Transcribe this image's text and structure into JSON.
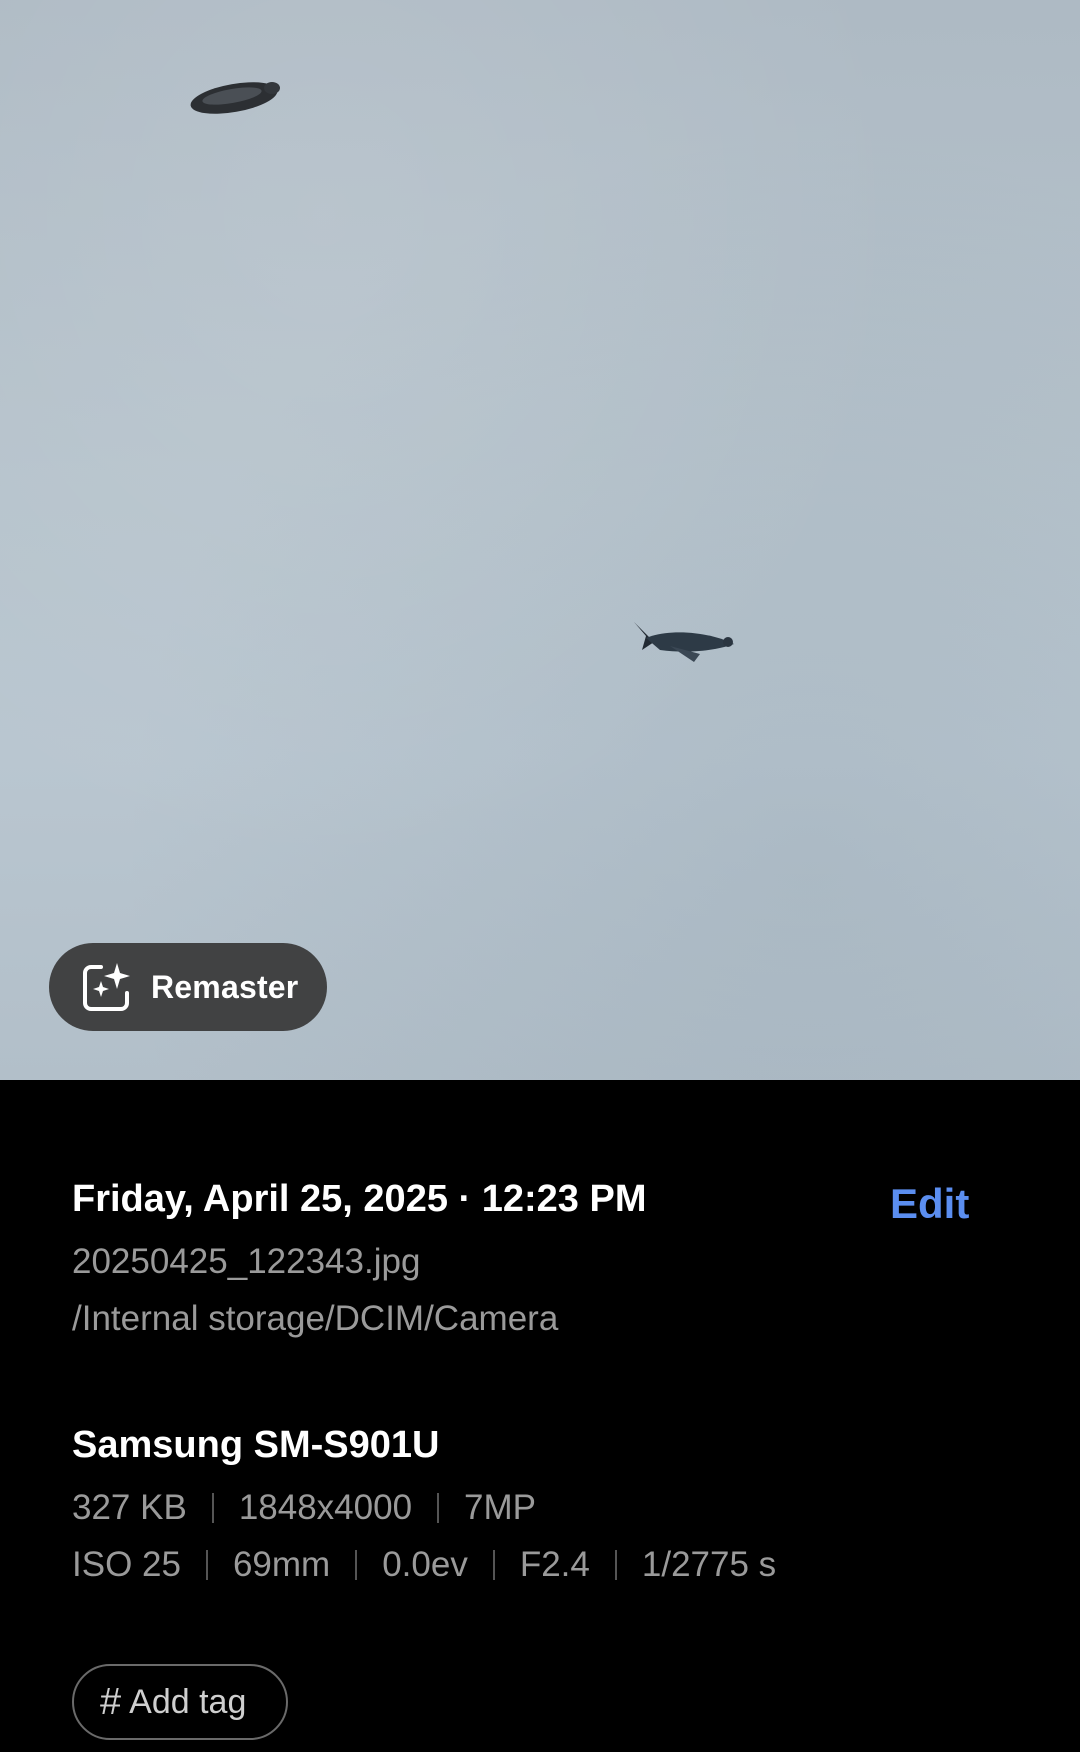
{
  "photo": {
    "subject_icon": "bird-icon"
  },
  "remaster": {
    "label": "Remaster",
    "icon": "sparkle-image-icon"
  },
  "details": {
    "date": "Friday, April 25, 2025",
    "separator": "·",
    "time": "12:23 PM",
    "edit_label": "Edit",
    "filename": "20250425_122343.jpg",
    "path": "/Internal storage/DCIM/Camera",
    "device": "Samsung SM-S901U",
    "specs_row1": [
      "327 KB",
      "1848x4000",
      "7MP"
    ],
    "specs_row2": [
      "ISO 25",
      "69mm",
      "0.0ev",
      "F2.4",
      "1/2775 s"
    ],
    "add_tag_icon": "#",
    "add_tag_label": "Add tag"
  },
  "colors": {
    "accent": "#5b8ef0",
    "background": "#000000",
    "secondary_text": "#9a9a9a"
  }
}
